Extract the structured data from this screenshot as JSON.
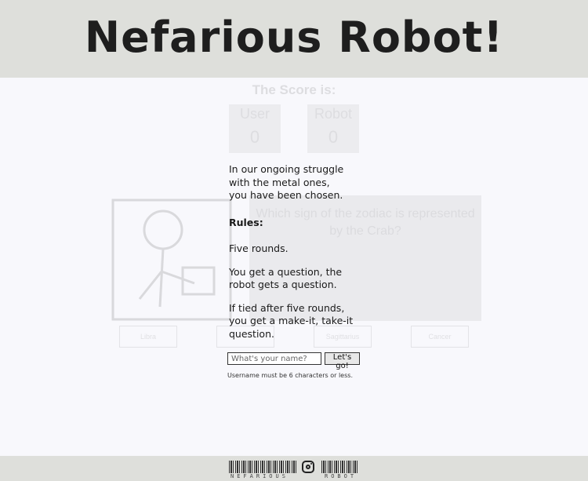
{
  "header": {
    "title": "Nefarious Robot!"
  },
  "game": {
    "score_title": "The Score is:",
    "user_label": "User",
    "user_score": "0",
    "robot_label": "Robot",
    "robot_score": "0",
    "question": "Which sign of the zodiac is represented by the Crab?",
    "answers": [
      "Libra",
      "",
      "Sagittarius",
      "Cancer"
    ]
  },
  "modal": {
    "intro_1": "In our ongoing struggle",
    "intro_2": "with the metal ones,",
    "intro_3": "you have been chosen.",
    "rules_heading": "Rules:",
    "rule_1": "Five rounds.",
    "rule_2": "You get a question, the robot gets a question.",
    "rule_3": "If tied after five rounds, you get a make-it, take-it question.",
    "name_placeholder": "What's your name?",
    "submit_label": "Let's go!",
    "hint": "Username must be 6 characters or less."
  },
  "footer": {
    "left_text": "NEFARIOUS",
    "right_text": "ROBOT",
    "instagram_icon": "instagram-icon"
  }
}
